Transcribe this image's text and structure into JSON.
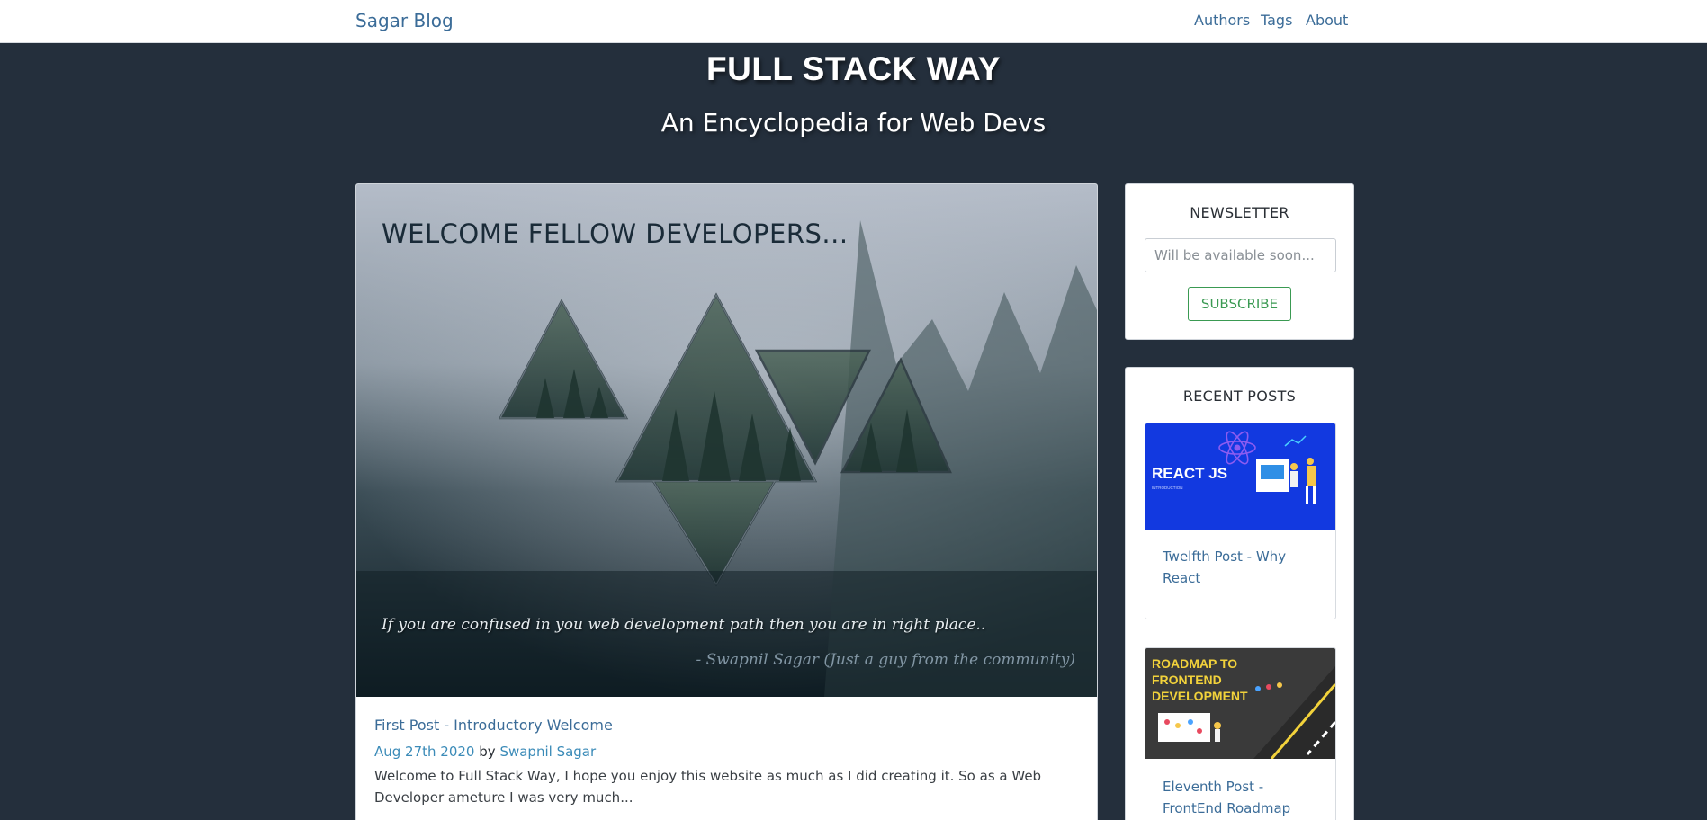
{
  "navbar": {
    "brand": "Sagar Blog",
    "links": [
      {
        "label": "Authors"
      },
      {
        "label": "Tags"
      },
      {
        "label": "About"
      }
    ]
  },
  "hero": {
    "title": "FULL STACK WAY",
    "subtitle": "An Encyclopedia for Web Devs"
  },
  "featured_post": {
    "image_heading": "WELCOME FELLOW DEVELOPERS...",
    "image_quote": "If you are confused in you web development path then you are in right place..",
    "image_quote_author": "- Swapnil Sagar  (Just a guy from the community)",
    "title": "First Post - Introductory Welcome",
    "date": "Aug 27th 2020",
    "by": "by",
    "author": "Swapnil Sagar",
    "excerpt": "Welcome to Full Stack Way, I hope you enjoy this website as much as I did creating it. So as a Web Developer ameture I was very much..."
  },
  "newsletter": {
    "title": "NEWSLETTER",
    "placeholder": "Will be available soon...",
    "button": "SUBSCRIBE"
  },
  "recent_posts": {
    "title": "RECENT POSTS",
    "items": [
      {
        "title": "Twelfth Post - Why React",
        "thumb_text": "REACT JS",
        "thumb_sub": "INTRODUCTION"
      },
      {
        "title": "Eleventh Post - FrontEnd Roadmap",
        "thumb_text_lines": [
          "ROADMAP TO",
          "FRONTEND",
          "DEVELOPMENT"
        ]
      }
    ]
  },
  "colors": {
    "page_bg": "#242f3c",
    "link": "#3b6c98",
    "accent_green": "#3a9a52"
  }
}
